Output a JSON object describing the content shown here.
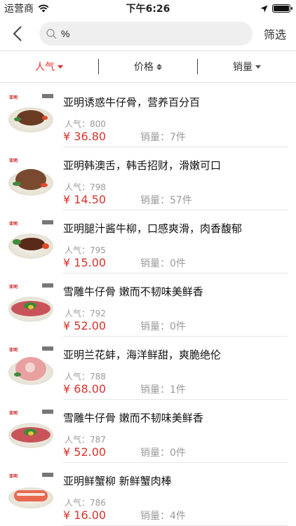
{
  "status_bar": {
    "carrier": "运营商",
    "time": "下午6:26"
  },
  "search": {
    "value": "%",
    "filter_label": "筛选"
  },
  "sort_tabs": [
    {
      "label": "人气",
      "active": true
    },
    {
      "label": "价格",
      "active": false
    },
    {
      "label": "销量",
      "active": false
    }
  ],
  "colors": {
    "accent": "#e0302e",
    "price": "#d9322c"
  },
  "products": [
    {
      "title": "亚明诱惑牛仔骨，营养百分百",
      "popularity": "人气：800",
      "price": "¥ 36.80",
      "sales": "销量：7件",
      "food_color": "#6b3a22"
    },
    {
      "title": "亚明韩澳舌，韩舌招财，滑嫩可口",
      "popularity": "人气：798",
      "price": "¥ 14.50",
      "sales": "销量：57件",
      "food_color": "#7a4a30"
    },
    {
      "title": "亚明腿汁酱牛柳，口感爽滑，肉香馥郁",
      "popularity": "人气：795",
      "price": "¥ 15.00",
      "sales": "销量：0件",
      "food_color": "#5a2a18"
    },
    {
      "title": "雪雕牛仔骨 嫩而不韧味美鲜香",
      "popularity": "人气：792",
      "price": "¥ 52.00",
      "sales": "销量：0件",
      "food_color": "#c8545a"
    },
    {
      "title": "亚明兰花蚌，海洋鲜甜，爽脆绝伦",
      "popularity": "人气：788",
      "price": "¥ 68.00",
      "sales": "销量：1件",
      "food_color": "#e8a0a0"
    },
    {
      "title": "雪雕牛仔骨 嫩而不韧味美鲜香",
      "popularity": "人气：787",
      "price": "¥ 52.00",
      "sales": "销量：0件",
      "food_color": "#c8545a"
    },
    {
      "title": "亚明鲜蟹柳 新鲜蟹肉棒",
      "popularity": "人气：786",
      "price": "¥ 16.00",
      "sales": "销量：4件",
      "food_color": "#e86850"
    }
  ]
}
